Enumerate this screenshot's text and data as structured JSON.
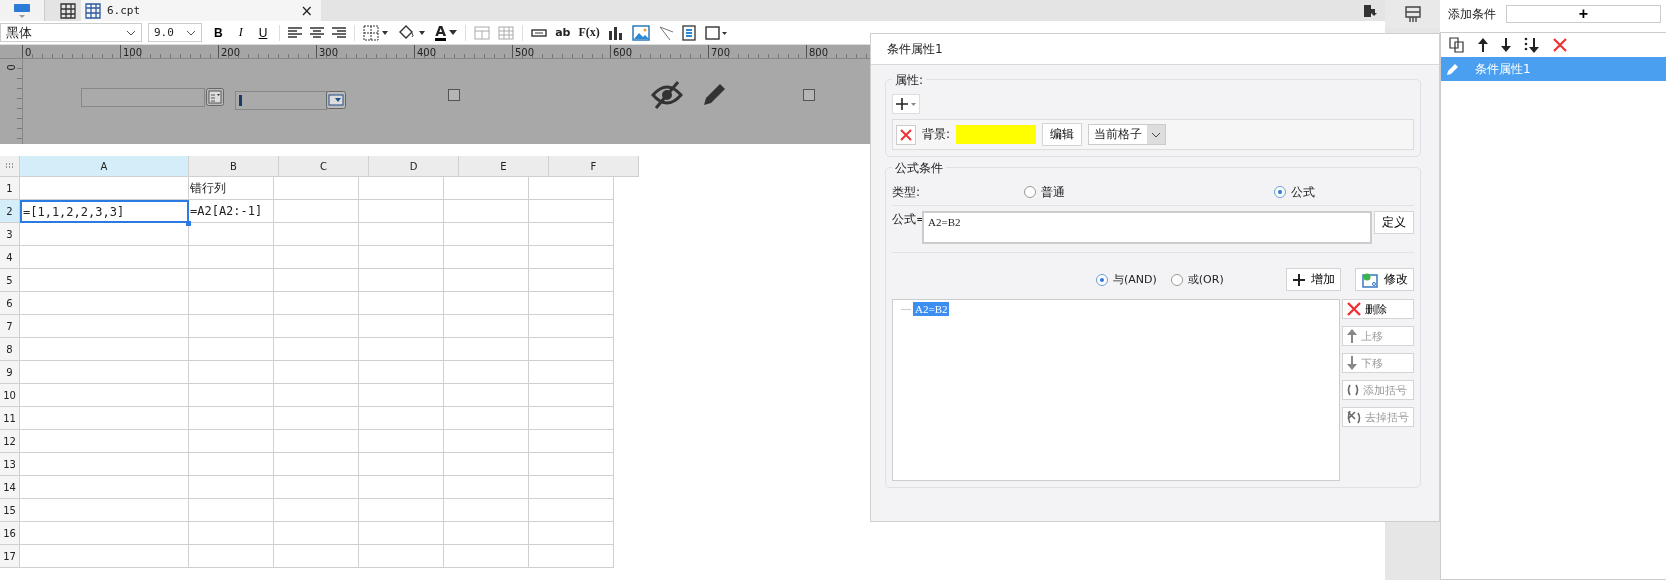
{
  "file_tab": {
    "label": "6.cpt",
    "close": "×"
  },
  "toolbar": {
    "font": "黑体",
    "size": "9.0",
    "format_buttons": [
      "B",
      "I",
      "U"
    ],
    "font_color_letter": "A",
    "text_tools": [
      "ab",
      "F(x)"
    ]
  },
  "ruler": {
    "ticks": [
      "0",
      "100",
      "200",
      "300",
      "400",
      "500",
      "600",
      "700",
      "800"
    ],
    "vertical": "0"
  },
  "canvas": {
    "checkboxes": [
      {
        "checked": false
      },
      {
        "checked": false
      }
    ]
  },
  "sheet": {
    "columns": [
      {
        "label": "A",
        "selected": true
      },
      {
        "label": "B",
        "selected": false
      },
      {
        "label": "C",
        "selected": false
      },
      {
        "label": "D",
        "selected": false
      },
      {
        "label": "E",
        "selected": false
      },
      {
        "label": "F",
        "selected": false
      }
    ],
    "rows": [
      {
        "label": "1",
        "selected": false,
        "cells": {
          "B": "错行列"
        }
      },
      {
        "label": "2",
        "selected": true,
        "cells": {
          "A": "=[1,1,2,2,3,3]",
          "B": "=A2[A2:-1]"
        }
      },
      {
        "label": "3",
        "selected": false,
        "cells": {}
      },
      {
        "label": "4",
        "selected": false,
        "cells": {}
      },
      {
        "label": "5",
        "selected": false,
        "cells": {}
      },
      {
        "label": "6",
        "selected": false,
        "cells": {}
      },
      {
        "label": "7",
        "selected": false,
        "cells": {}
      },
      {
        "label": "8",
        "selected": false,
        "cells": {}
      },
      {
        "label": "9",
        "selected": false,
        "cells": {}
      },
      {
        "label": "10",
        "selected": false,
        "cells": {}
      },
      {
        "label": "11",
        "selected": false,
        "cells": {}
      },
      {
        "label": "12",
        "selected": false,
        "cells": {}
      },
      {
        "label": "13",
        "selected": false,
        "cells": {}
      },
      {
        "label": "14",
        "selected": false,
        "cells": {}
      },
      {
        "label": "15",
        "selected": false,
        "cells": {}
      },
      {
        "label": "16",
        "selected": false,
        "cells": {}
      },
      {
        "label": "17",
        "selected": false,
        "cells": {}
      }
    ]
  },
  "dialog": {
    "title": "条件属性1",
    "attributes_legend": "属性:",
    "attribute": {
      "label": "背景:",
      "color": "#ffff00",
      "edit_button": "编辑",
      "scope": "当前格子"
    },
    "formula_legend": "公式条件",
    "type_label": "类型:",
    "types": [
      {
        "label": "普通",
        "selected": false
      },
      {
        "label": "公式",
        "selected": true
      }
    ],
    "formula_label": "公式=",
    "formula_value": "A2=B2",
    "define_button": "定义",
    "logic": [
      {
        "label": "与(AND)",
        "selected": true
      },
      {
        "label": "或(OR)",
        "selected": false
      }
    ],
    "add_button": "增加",
    "modify_button": "修改",
    "conditions": [
      {
        "text": "A2=B2",
        "selected": true
      }
    ],
    "side_buttons": [
      {
        "kind": "delete",
        "label": "删除",
        "disabled": false
      },
      {
        "kind": "up",
        "label": "上移",
        "disabled": true
      },
      {
        "kind": "down",
        "label": "下移",
        "disabled": true
      },
      {
        "kind": "add_bracket",
        "label": "添加括号",
        "disabled": true
      },
      {
        "kind": "remove_bracket",
        "label": "去掉括号",
        "disabled": true
      }
    ]
  },
  "right_panel": {
    "title": "添加条件",
    "add_button": "+",
    "items": [
      {
        "label": "条件属性1",
        "selected": true
      }
    ]
  }
}
